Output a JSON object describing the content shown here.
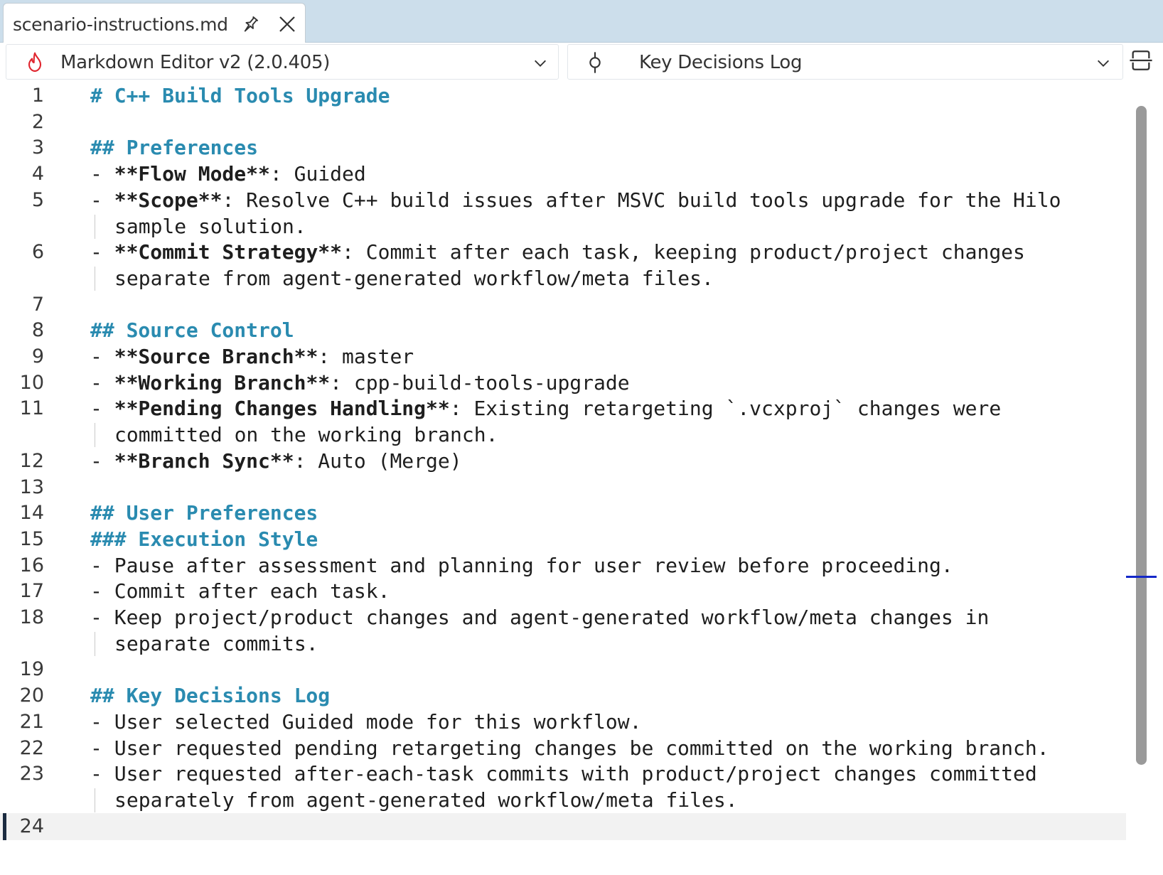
{
  "tab": {
    "title": "scenario-instructions.md"
  },
  "nav": {
    "project": "Markdown Editor v2 (2.0.405)",
    "section": "Key Decisions Log"
  },
  "colors": {
    "heading": "#2a8bb0",
    "tabstrip": "#ccdeeb",
    "scroll_marker": "#1428c8"
  },
  "icons": [
    "pin-icon",
    "close-icon",
    "flame-icon",
    "chevron-down-icon",
    "commit-node-icon",
    "split-editor-icon"
  ],
  "lines": [
    {
      "n": "1",
      "segs": [
        [
          "hd",
          "# C++ Build Tools Upgrade"
        ]
      ]
    },
    {
      "n": "2",
      "segs": []
    },
    {
      "n": "3",
      "segs": [
        [
          "hd",
          "## Preferences"
        ]
      ]
    },
    {
      "n": "4",
      "segs": [
        [
          "",
          "- "
        ],
        [
          "b",
          "**Flow Mode**"
        ],
        [
          "",
          ": Guided"
        ]
      ]
    },
    {
      "n": "5",
      "segs": [
        [
          "",
          "- "
        ],
        [
          "b",
          "**Scope**"
        ],
        [
          "",
          ": Resolve C++ build issues after MSVC build tools upgrade for the Hilo"
        ]
      ],
      "cont": "sample solution."
    },
    {
      "n": "6",
      "segs": [
        [
          "",
          "- "
        ],
        [
          "b",
          "**Commit Strategy**"
        ],
        [
          "",
          ": Commit after each task, keeping product/project changes"
        ]
      ],
      "cont": "separate from agent-generated workflow/meta files."
    },
    {
      "n": "7",
      "segs": []
    },
    {
      "n": "8",
      "segs": [
        [
          "hd",
          "## Source Control"
        ]
      ]
    },
    {
      "n": "9",
      "segs": [
        [
          "",
          "- "
        ],
        [
          "b",
          "**Source Branch**"
        ],
        [
          "",
          ": master"
        ]
      ]
    },
    {
      "n": "10",
      "segs": [
        [
          "",
          "- "
        ],
        [
          "b",
          "**Working Branch**"
        ],
        [
          "",
          ": cpp-build-tools-upgrade"
        ]
      ]
    },
    {
      "n": "11",
      "segs": [
        [
          "",
          "- "
        ],
        [
          "b",
          "**Pending Changes Handling**"
        ],
        [
          "",
          ": Existing retargeting `.vcxproj` changes were"
        ]
      ],
      "cont": "committed on the working branch."
    },
    {
      "n": "12",
      "segs": [
        [
          "",
          "- "
        ],
        [
          "b",
          "**Branch Sync**"
        ],
        [
          "",
          ": Auto (Merge)"
        ]
      ]
    },
    {
      "n": "13",
      "segs": []
    },
    {
      "n": "14",
      "segs": [
        [
          "hd",
          "## User Preferences"
        ]
      ]
    },
    {
      "n": "15",
      "segs": [
        [
          "hd",
          "### Execution Style"
        ]
      ]
    },
    {
      "n": "16",
      "segs": [
        [
          "",
          "- Pause after assessment and planning for user review before proceeding."
        ]
      ]
    },
    {
      "n": "17",
      "segs": [
        [
          "",
          "- Commit after each task."
        ]
      ]
    },
    {
      "n": "18",
      "segs": [
        [
          "",
          "- Keep project/product changes and agent-generated workflow/meta changes in"
        ]
      ],
      "cont": "separate commits."
    },
    {
      "n": "19",
      "segs": []
    },
    {
      "n": "20",
      "segs": [
        [
          "hd",
          "## Key Decisions Log"
        ]
      ]
    },
    {
      "n": "21",
      "segs": [
        [
          "",
          "- User selected Guided mode for this workflow."
        ]
      ]
    },
    {
      "n": "22",
      "segs": [
        [
          "",
          "- User requested pending retargeting changes be committed on the working branch."
        ]
      ]
    },
    {
      "n": "23",
      "segs": [
        [
          "",
          "- User requested after-each-task commits with product/project changes committed"
        ]
      ],
      "cont": "separately from agent-generated workflow/meta files."
    },
    {
      "n": "24",
      "segs": [],
      "current": true
    }
  ]
}
